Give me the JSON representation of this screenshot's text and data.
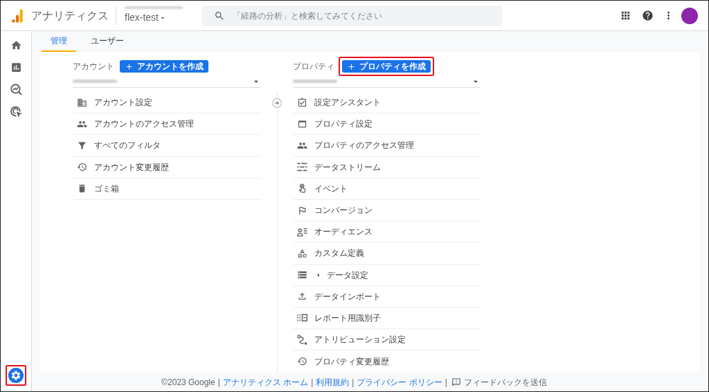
{
  "header": {
    "app_name": "アナリティクス",
    "property": "flex-test",
    "search": {
      "placeholder": "「経路の分析」と検索してみてください"
    }
  },
  "nav_rail": [
    {
      "selected": false
    },
    {
      "selected": false
    },
    {
      "selected": false
    },
    {
      "selected": false
    }
  ],
  "admin_button": {
    "selected": true,
    "highlighted": true
  },
  "tabs": [
    {
      "label": "管理",
      "selected": true
    },
    {
      "label": "ユーザー",
      "selected": false
    }
  ],
  "account": {
    "label": "アカウント",
    "create_button": {
      "label": "アカウントを作成",
      "highlighted": false
    },
    "items": [
      {
        "label": "アカウント設定",
        "kind": "link"
      },
      {
        "label": "アカウントのアクセス管理",
        "kind": "link"
      },
      {
        "label": "すべてのフィルタ",
        "kind": "link"
      },
      {
        "label": "アカウント変更履歴",
        "kind": "link"
      },
      {
        "label": "ゴミ箱",
        "kind": "link"
      }
    ]
  },
  "property": {
    "label": "プロパティ",
    "create_button": {
      "label": "プロパティを作成",
      "highlighted": true
    },
    "items": [
      {
        "label": "設定アシスタント",
        "kind": "link"
      },
      {
        "label": "プロパティ設定",
        "kind": "link"
      },
      {
        "label": "プロパティのアクセス管理",
        "kind": "link"
      },
      {
        "label": "データストリーム",
        "kind": "link"
      },
      {
        "label": "イベント",
        "kind": "link"
      },
      {
        "label": "コンバージョン",
        "kind": "link"
      },
      {
        "label": "オーディエンス",
        "kind": "link"
      },
      {
        "label": "カスタム定義",
        "kind": "link"
      },
      {
        "label": "データ設定",
        "kind": "group",
        "expanded": false
      },
      {
        "label": "データインポート",
        "kind": "link"
      },
      {
        "label": "レポート用識別子",
        "kind": "link"
      },
      {
        "label": "アトリビューション設定",
        "kind": "link"
      },
      {
        "label": "プロパティ変更履歴",
        "kind": "link"
      }
    ]
  },
  "footer": [
    {
      "kind": "text",
      "text": "©2023 Google"
    },
    {
      "kind": "separator",
      "text": "|"
    },
    {
      "kind": "link",
      "text": "アナリティクス ホーム"
    },
    {
      "kind": "separator",
      "text": "|"
    },
    {
      "kind": "link",
      "text": "利用規約"
    },
    {
      "kind": "separator",
      "text": "|"
    },
    {
      "kind": "link",
      "text": "プライバシー ポリシー"
    },
    {
      "kind": "separator",
      "text": "|"
    },
    {
      "kind": "feedback",
      "text": "フィードバックを送信"
    }
  ]
}
